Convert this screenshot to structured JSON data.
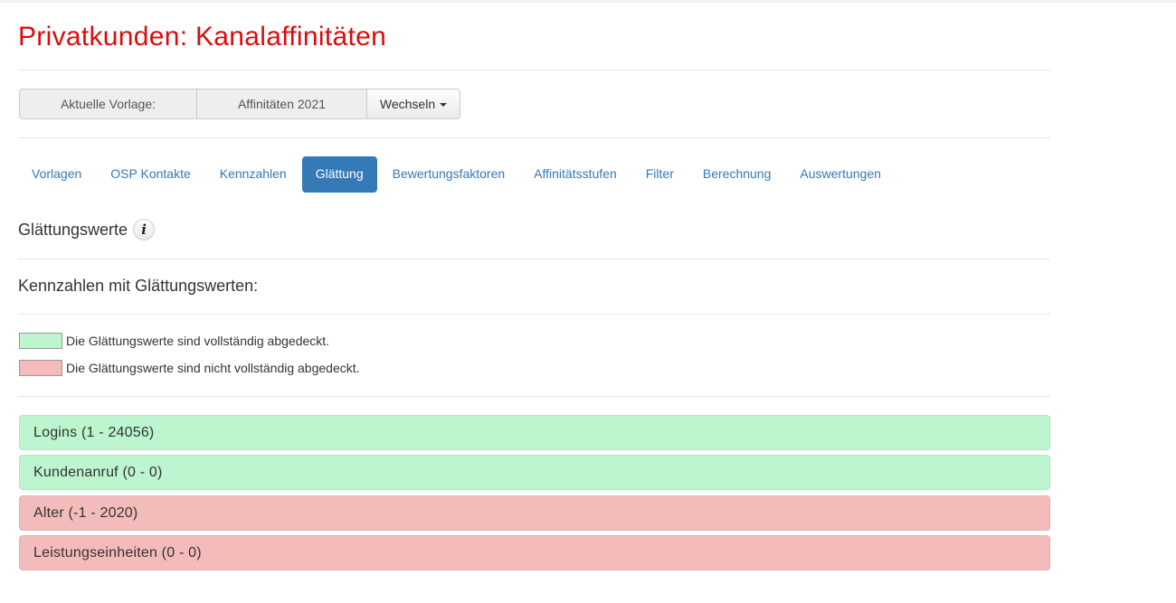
{
  "page": {
    "title": "Privatkunden: Kanalaffinitäten"
  },
  "template_bar": {
    "label": "Aktuelle Vorlage:",
    "value": "Affinitäten 2021",
    "switch_label": "Wechseln"
  },
  "tabs": [
    {
      "label": "Vorlagen",
      "active": false
    },
    {
      "label": "OSP Kontakte",
      "active": false
    },
    {
      "label": "Kennzahlen",
      "active": false
    },
    {
      "label": "Glättung",
      "active": true
    },
    {
      "label": "Bewertungsfaktoren",
      "active": false
    },
    {
      "label": "Affinitätsstufen",
      "active": false
    },
    {
      "label": "Filter",
      "active": false
    },
    {
      "label": "Berechnung",
      "active": false
    },
    {
      "label": "Auswertungen",
      "active": false
    }
  ],
  "section": {
    "title": "Glättungswerte",
    "info_icon": "info-icon",
    "subtitle": "Kennzahlen mit Glättungswerten:"
  },
  "legend": [
    {
      "color": "#bcf5ce",
      "text": "Die Glättungswerte sind vollständig abgedeckt."
    },
    {
      "color": "#f4bbbb",
      "text": "Die Glättungswerte sind nicht vollständig abgedeckt."
    }
  ],
  "kennzahlen": [
    {
      "label": "Logins (1 - 24056)",
      "status": "covered"
    },
    {
      "label": "Kundenanruf (0 - 0)",
      "status": "covered"
    },
    {
      "label": "Alter (-1 - 2020)",
      "status": "not-covered"
    },
    {
      "label": "Leistungseinheiten (0 - 0)",
      "status": "not-covered"
    }
  ],
  "colors": {
    "title_red": "#dd0b0b",
    "link_blue": "#337ab7",
    "covered_green": "#bcf5ce",
    "not_covered_red": "#f4bbbb"
  }
}
